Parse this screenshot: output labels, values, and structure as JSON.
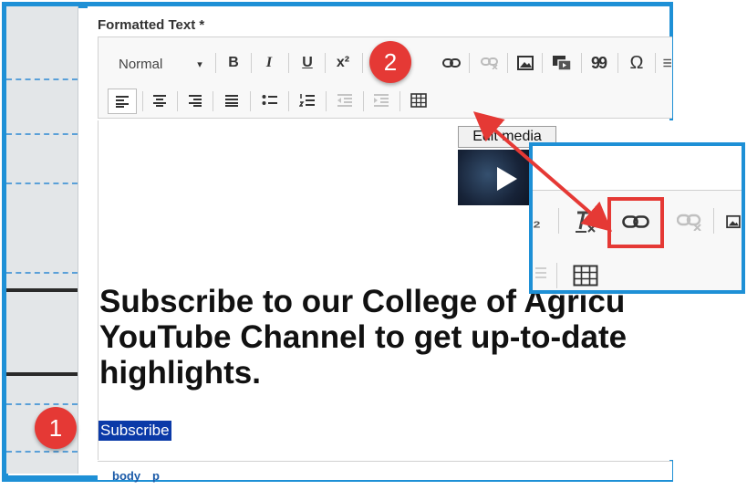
{
  "form": {
    "field_label": "Formatted Text *"
  },
  "toolbar": {
    "format_select": "Normal",
    "bold": "B",
    "italic": "I",
    "underline": "U",
    "superscript": "x²",
    "blockquote": "99",
    "special_char": "Ω"
  },
  "content": {
    "edit_media_button": "Edit media",
    "heading_line1": "Subscribe to our College of Agricu",
    "heading_line2": "YouTube Channel to get up-to-date",
    "heading_line3": "highlights.",
    "selected_text": "Subscribe"
  },
  "statusbar": {
    "crumbs": [
      "body",
      "p"
    ]
  },
  "annotations": {
    "step1": "1",
    "step2": "2",
    "accent_color": "#e53935",
    "frame_color": "#1e90d6"
  }
}
